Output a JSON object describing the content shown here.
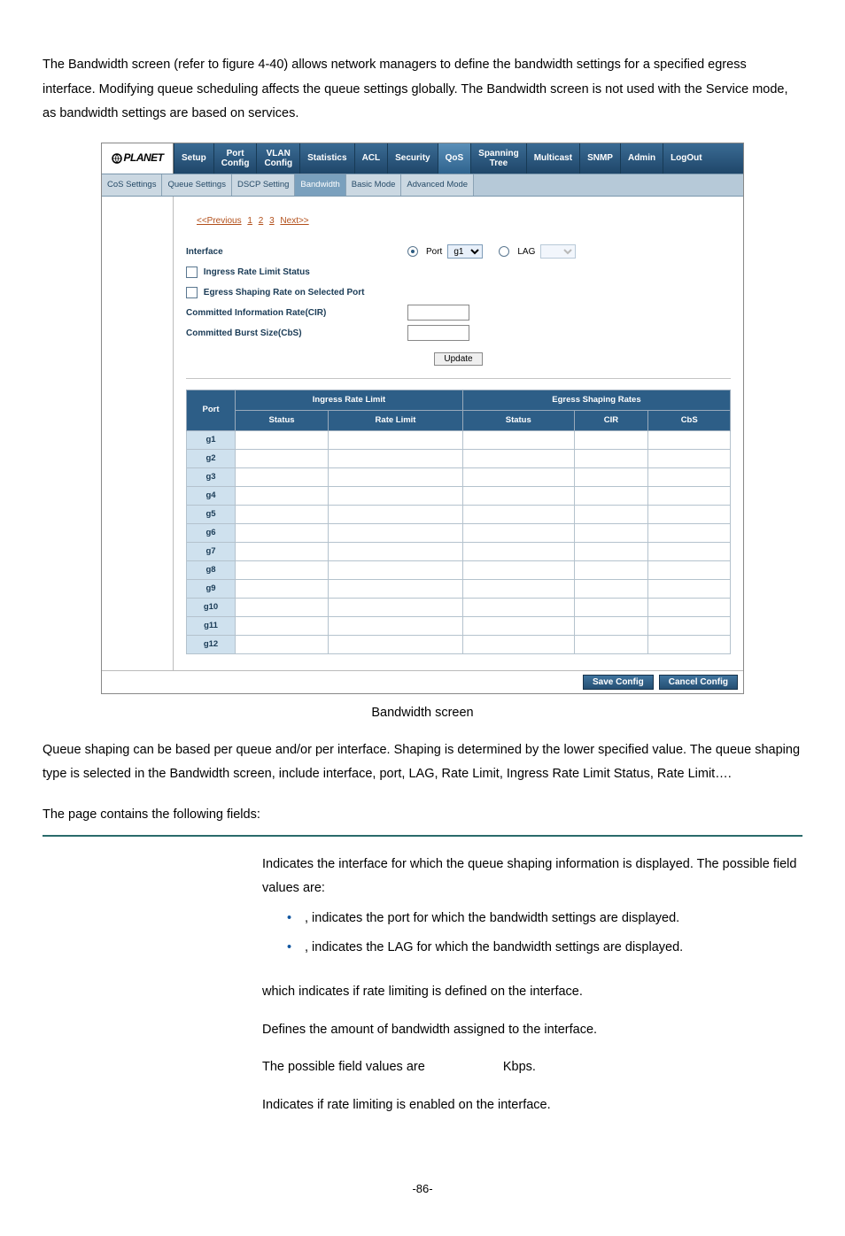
{
  "intro": "The Bandwidth screen (refer to figure 4-40) allows network managers to define the bandwidth settings for a specified egress interface. Modifying queue scheduling affects the queue settings globally. The Bandwidth screen is not used with the Service mode, as bandwidth settings are based on services.",
  "screenshot": {
    "logo": "PLANET",
    "main_tabs": [
      "Setup",
      "Port Config",
      "VLAN Config",
      "Statistics",
      "ACL",
      "Security",
      "QoS",
      "Spanning Tree",
      "Multicast",
      "SNMP",
      "Admin",
      "LogOut"
    ],
    "main_tab_active_index": 6,
    "sub_tabs": [
      "CoS Settings",
      "Queue Settings",
      "DSCP Setting",
      "Bandwidth",
      "Basic Mode",
      "Advanced Mode"
    ],
    "sub_tab_active_index": 3,
    "pager": {
      "prev": "<<Previous",
      "pages": [
        "1",
        "2",
        "3"
      ],
      "next": "Next>>"
    },
    "form": {
      "interface_label": "Interface",
      "port_label": "Port",
      "port_value": "g1",
      "lag_label": "LAG",
      "lag_value": "",
      "ingress_status_label": "Ingress Rate Limit Status",
      "egress_shaping_label": "Egress Shaping Rate on Selected Port",
      "cir_label": "Committed Information Rate(CIR)",
      "cbs_label": "Committed Burst Size(CbS)",
      "update_btn": "Update"
    },
    "table": {
      "headers": {
        "port": "Port",
        "irl": "Ingress Rate Limit",
        "irl_status": "Status",
        "irl_rate": "Rate Limit",
        "esr": "Egress Shaping Rates",
        "esr_status": "Status",
        "esr_cir": "CIR",
        "esr_cbs": "CbS"
      },
      "ports": [
        "g1",
        "g2",
        "g3",
        "g4",
        "g5",
        "g6",
        "g7",
        "g8",
        "g9",
        "g10",
        "g11",
        "g12"
      ]
    },
    "footer": {
      "save": "Save Config",
      "cancel": "Cancel Config"
    }
  },
  "caption": "Bandwidth screen",
  "after": "Queue shaping can be based per queue and/or per interface. Shaping is determined by the lower specified value. The queue shaping type is selected in the Bandwidth screen, include interface, port, LAG, Rate Limit, Ingress Rate Limit Status, Rate Limit….",
  "fields_intro": "The page contains the following fields:",
  "fields": {
    "interface_desc": "Indicates the interface for which the queue shaping information is displayed. The possible field values are:",
    "bullet_port": ", indicates the port for which the bandwidth settings are displayed.",
    "bullet_lag": ", indicates the LAG for which the bandwidth settings are displayed.",
    "row2": "which indicates if rate limiting is defined on the interface.",
    "row3a": "Defines the amount of bandwidth assigned to the interface.",
    "row3b_prefix": "The possible field values are",
    "row3b_unit": "Kbps.",
    "row4": "Indicates if rate limiting is enabled on the interface."
  },
  "page_number": "-86-"
}
